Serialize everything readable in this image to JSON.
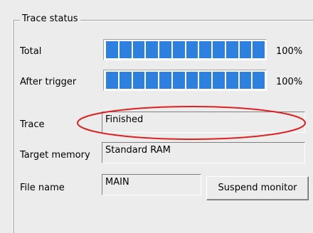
{
  "group": {
    "title": "Trace status"
  },
  "rows": {
    "total": {
      "label": "Total",
      "progress_fraction": 1.0,
      "percent": "100%"
    },
    "after_trigger": {
      "label": "After trigger",
      "progress_fraction": 1.0,
      "percent": "100%"
    },
    "trace": {
      "label": "Trace",
      "value": "Finished"
    },
    "target_memory": {
      "label": "Target memory",
      "value": "Standard RAM"
    },
    "file_name": {
      "label": "File name",
      "value": "MAIN"
    }
  },
  "buttons": {
    "suspend_monitor": "Suspend monitor"
  },
  "colors": {
    "progress_fill": "#2d7fe0",
    "annotation": "#e02020"
  }
}
